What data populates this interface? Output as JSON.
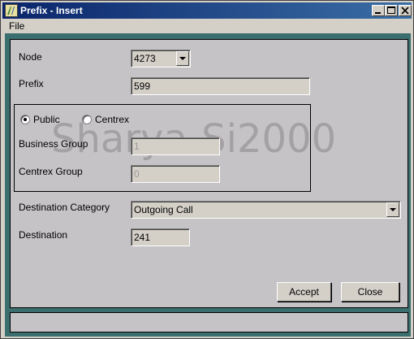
{
  "window": {
    "title": "Prefix - Insert",
    "controls": {
      "minimize": "minimize-icon",
      "maximize": "maximize-icon",
      "close": "close-icon"
    }
  },
  "menu": {
    "items": [
      "File"
    ]
  },
  "form": {
    "node": {
      "label": "Node",
      "value": "4273"
    },
    "prefix": {
      "label": "Prefix",
      "value": "599"
    },
    "type_group": {
      "options": [
        {
          "label": "Public",
          "selected": true
        },
        {
          "label": "Centrex",
          "selected": false
        }
      ],
      "business_group": {
        "label": "Business Group",
        "value": "1"
      },
      "centrex_group": {
        "label": "Centrex Group",
        "value": "0"
      }
    },
    "destination_category": {
      "label": "Destination Category",
      "value": "Outgoing Call"
    },
    "destination": {
      "label": "Destination",
      "value": "241"
    }
  },
  "watermark": "Sharya-Si2000",
  "buttons": {
    "accept": "Accept",
    "close": "Close"
  },
  "status_bar": {
    "text": ""
  }
}
